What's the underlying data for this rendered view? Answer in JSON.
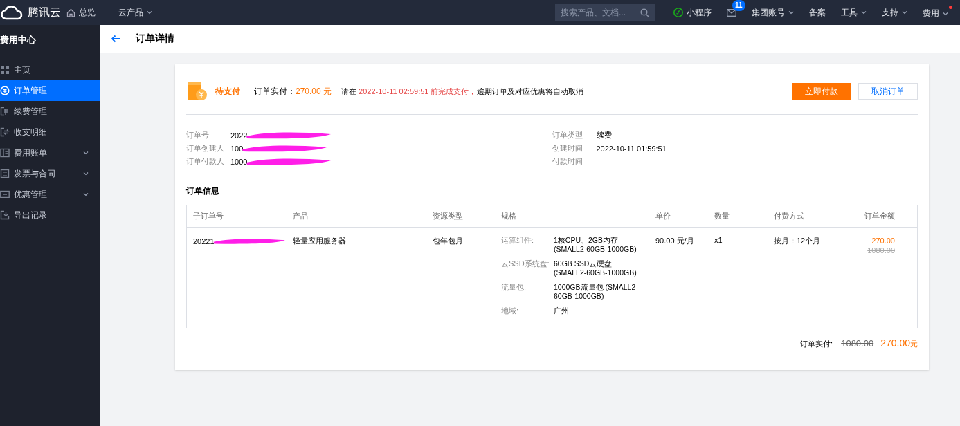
{
  "topbar": {
    "brand": "腾讯云",
    "nav": [
      {
        "label": "总览",
        "kind": "home",
        "dropdown": false
      },
      {
        "label": "云产品",
        "dropdown": true
      }
    ],
    "search": {
      "placeholder": "搜索产品、文档..."
    },
    "actions": [
      {
        "label": "小程序",
        "kind": "mini",
        "dropdown": false,
        "dot": false
      },
      {
        "kind": "mail",
        "badge": "11",
        "dropdown": false,
        "dot": false
      },
      {
        "label": "集团账号",
        "dropdown": true,
        "dot": false
      },
      {
        "label": "备案",
        "dropdown": false,
        "dot": false
      },
      {
        "label": "工具",
        "dropdown": true,
        "dot": false
      },
      {
        "label": "支持",
        "dropdown": true,
        "dot": false
      },
      {
        "label": "费用",
        "dropdown": true,
        "dot": true
      }
    ]
  },
  "sidebar": {
    "title": "费用中心",
    "items": [
      {
        "label": "主页",
        "kind": "grid",
        "expandable": false,
        "selected": false
      },
      {
        "label": "订单管理",
        "kind": "coin",
        "expandable": false,
        "selected": true
      },
      {
        "label": "续费管理",
        "kind": "renew",
        "expandable": false,
        "selected": false
      },
      {
        "label": "收支明细",
        "kind": "swap",
        "expandable": false,
        "selected": false
      },
      {
        "label": "费用账单",
        "kind": "book",
        "expandable": true,
        "selected": false
      },
      {
        "label": "发票与合同",
        "kind": "doc",
        "expandable": true,
        "selected": false
      },
      {
        "label": "优惠管理",
        "kind": "ticket",
        "expandable": true,
        "selected": false
      },
      {
        "label": "导出记录",
        "kind": "export",
        "expandable": false,
        "selected": false
      }
    ]
  },
  "page": {
    "title": "订单详情"
  },
  "status": {
    "label": "待支付",
    "amount_label": "订单实付：",
    "amount": "270.00 元",
    "message": [
      {
        "text": "请在 ",
        "highlight": false
      },
      {
        "text": "2022-10-11 02:59:51 前完成支付，",
        "highlight": true
      },
      {
        "text": "逾期订单及对应优惠将自动取消",
        "highlight": false
      }
    ],
    "buttons": [
      {
        "label": "立即付款",
        "primary": true
      },
      {
        "label": "取消订单",
        "primary": false
      }
    ]
  },
  "info_left": [
    {
      "label": "订单号",
      "value": "2022",
      "redacted": true
    },
    {
      "label": "订单创建人",
      "value": "100",
      "redacted": true
    },
    {
      "label": "订单付款人",
      "value": "1000",
      "redacted": true
    }
  ],
  "info_right": [
    {
      "label": "订单类型",
      "value": "续费",
      "redacted": false
    },
    {
      "label": "创建时间",
      "value": "2022-10-11 01:59:51",
      "redacted": false
    },
    {
      "label": "付款时间",
      "value": "- -",
      "redacted": false
    }
  ],
  "order_section": {
    "title": "订单信息",
    "columns": [
      "子订单号",
      "产品",
      "资源类型",
      "规格",
      "单价",
      "数量",
      "付费方式",
      "订单金额"
    ],
    "rows": [
      {
        "sub_order": "20221",
        "sub_order_redacted": true,
        "product": "轻量应用服务器",
        "resource_type": "包年包月",
        "specs": [
          {
            "label": "运算组件:",
            "value": "1核CPU、2GB内存 (SMALL2-60GB-1000GB)"
          },
          {
            "label": "云SSD系统盘:",
            "value": "60GB SSD云硬盘 (SMALL2-60GB-1000GB)"
          },
          {
            "label": "流量包:",
            "value": "1000GB流量包 (SMALL2-60GB-1000GB)"
          },
          {
            "label": "地域:",
            "value": "广州"
          }
        ],
        "unit_price": "90.00 元/月",
        "quantity": "x1",
        "billing": "按月：12个月",
        "amount": "270.00",
        "original_amount": "1080.00"
      }
    ]
  },
  "total": {
    "label": "订单实付:",
    "original": "1080.00",
    "amount": "270.00",
    "unit": "元"
  }
}
